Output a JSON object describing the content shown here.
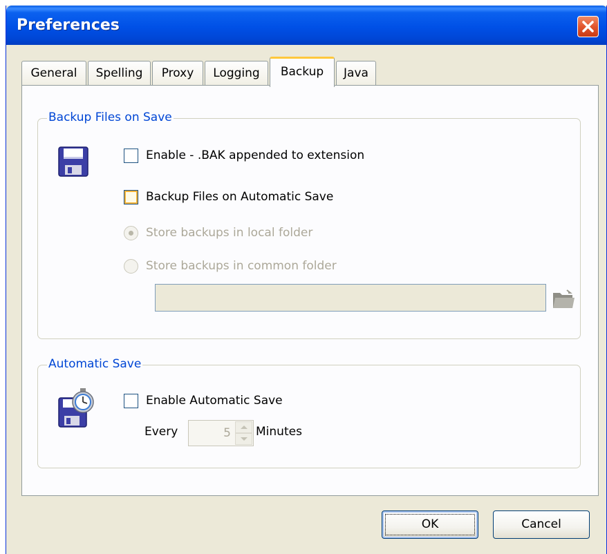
{
  "window": {
    "title": "Preferences"
  },
  "tabs": [
    {
      "label": "General"
    },
    {
      "label": "Spelling"
    },
    {
      "label": "Proxy"
    },
    {
      "label": "Logging"
    },
    {
      "label": "Backup",
      "active": true
    },
    {
      "label": "Java"
    }
  ],
  "backup_group": {
    "legend": "Backup Files on Save",
    "enable_bak": {
      "label": "Enable - .BAK appended to extension",
      "checked": false
    },
    "backup_auto_save": {
      "label": "Backup Files on Automatic Save",
      "checked": false
    },
    "store_local": {
      "label": "Store backups in local folder",
      "selected": true,
      "enabled": false
    },
    "store_common": {
      "label": "Store backups in common folder",
      "selected": false,
      "enabled": false
    },
    "folder_path": {
      "value": ""
    }
  },
  "autosave_group": {
    "legend": "Automatic Save",
    "enable_auto_save": {
      "label": "Enable Automatic Save",
      "checked": false
    },
    "every_label": "Every",
    "interval_value": "5",
    "minutes_label": "Minutes"
  },
  "footer": {
    "ok_label": "OK",
    "cancel_label": "Cancel"
  },
  "colors": {
    "titlebar": "#0054e3",
    "accent_tab": "#ffc83c",
    "legend": "#0046d5",
    "dialog_bg": "#ece9d8"
  }
}
